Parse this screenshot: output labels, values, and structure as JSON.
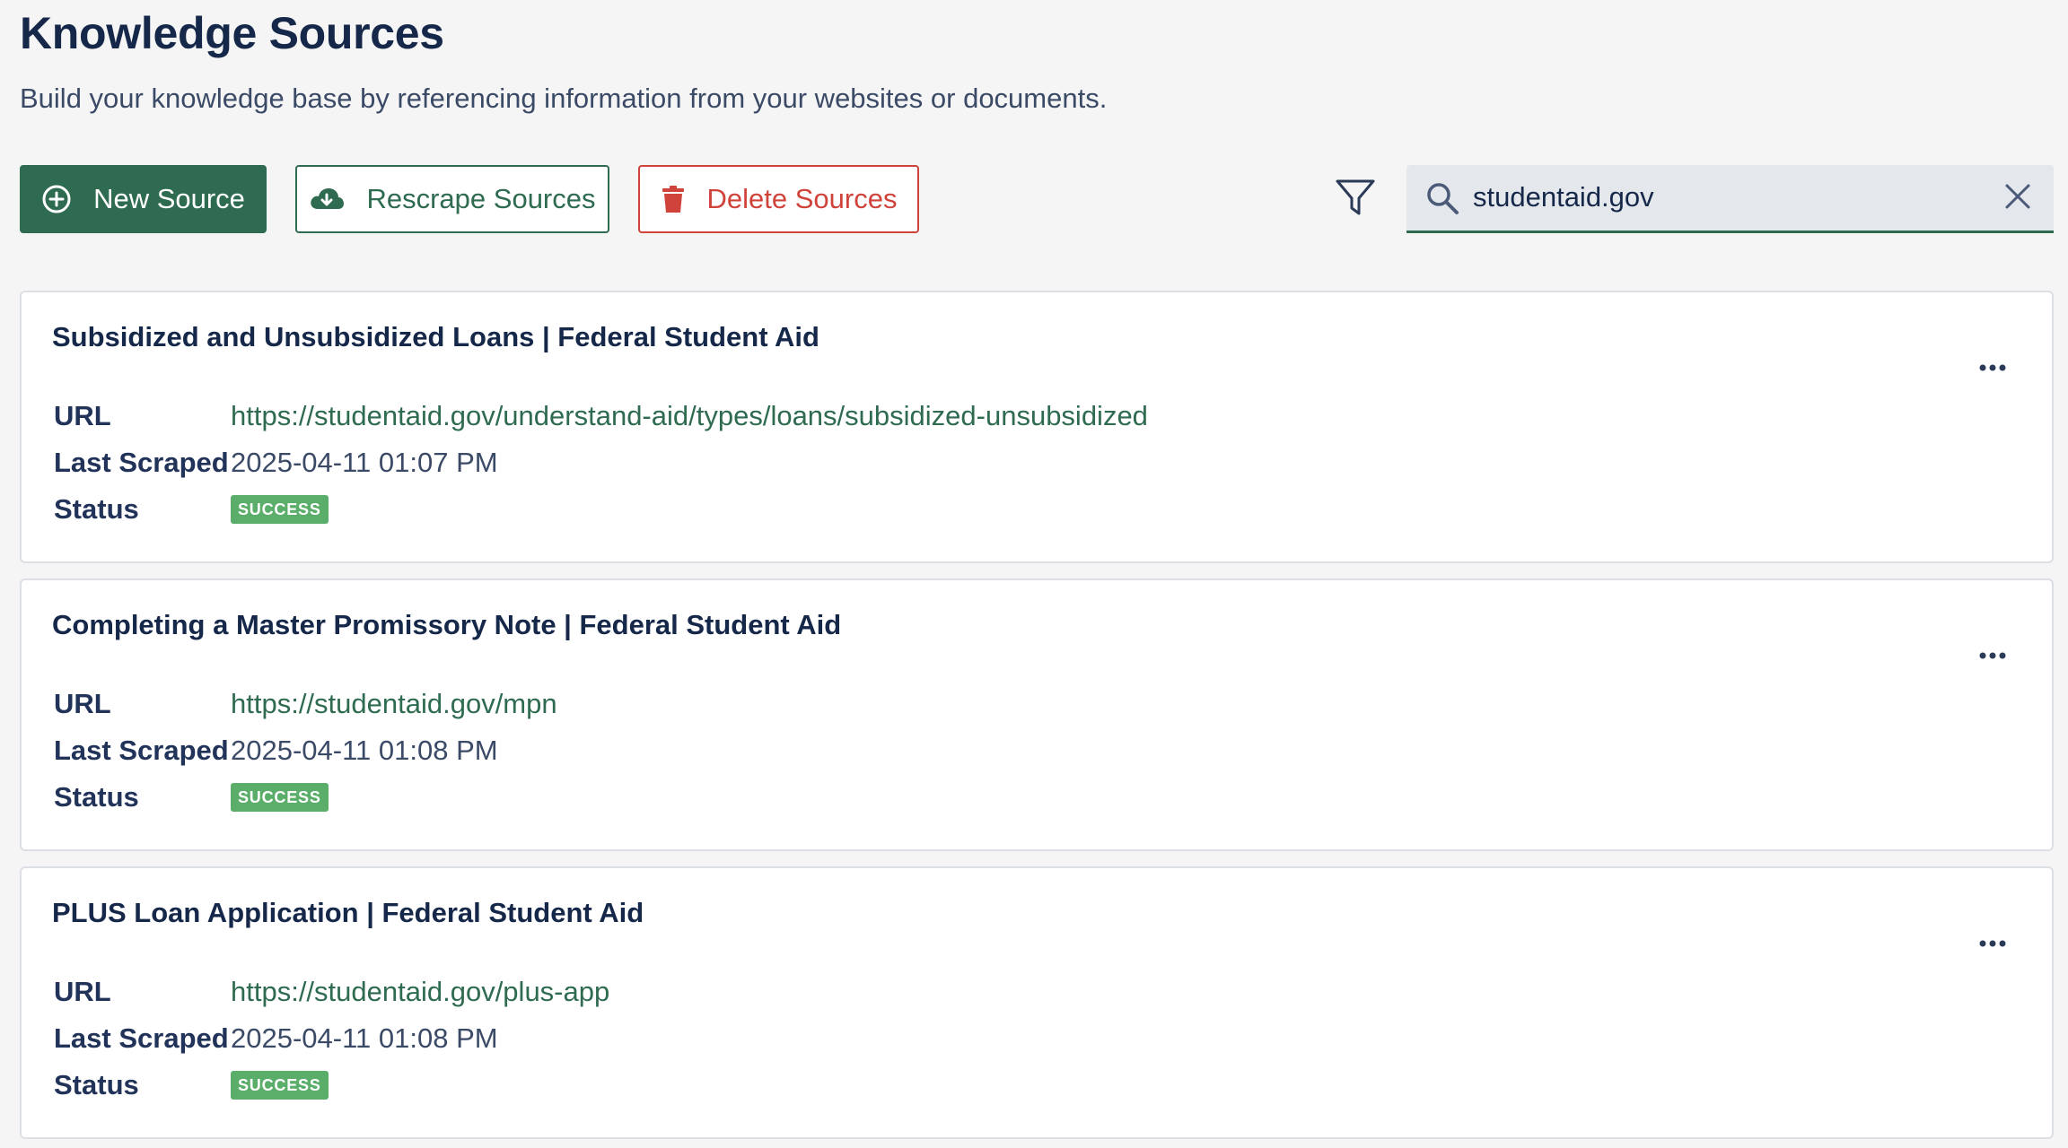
{
  "header": {
    "title": "Knowledge Sources",
    "subtitle": "Build your knowledge base by referencing information from your websites or documents."
  },
  "toolbar": {
    "new_source_label": "New Source",
    "rescrape_label": "Rescrape Sources",
    "delete_label": "Delete Sources",
    "filter_icon": "filter-icon"
  },
  "search": {
    "value": "studentaid.gov",
    "icon": "search-icon",
    "clear_icon": "close-icon"
  },
  "labels": {
    "url": "URL",
    "last_scraped": "Last Scraped",
    "status": "Status"
  },
  "sources": [
    {
      "title": "Subsidized and Unsubsidized Loans | Federal Student Aid",
      "url": "https://studentaid.gov/understand-aid/types/loans/subsidized-unsubsidized",
      "last_scraped": "2025-04-11 01:07 PM",
      "status": "SUCCESS"
    },
    {
      "title": "Completing a Master Promissory Note | Federal Student Aid",
      "url": "https://studentaid.gov/mpn",
      "last_scraped": "2025-04-11 01:08 PM",
      "status": "SUCCESS"
    },
    {
      "title": "PLUS Loan Application | Federal Student Aid",
      "url": "https://studentaid.gov/plus-app",
      "last_scraped": "2025-04-11 01:08 PM",
      "status": "SUCCESS"
    }
  ],
  "colors": {
    "primary": "#2e6b50",
    "danger": "#d0433b",
    "success_badge": "#5aae6a",
    "heading": "#16284a"
  }
}
